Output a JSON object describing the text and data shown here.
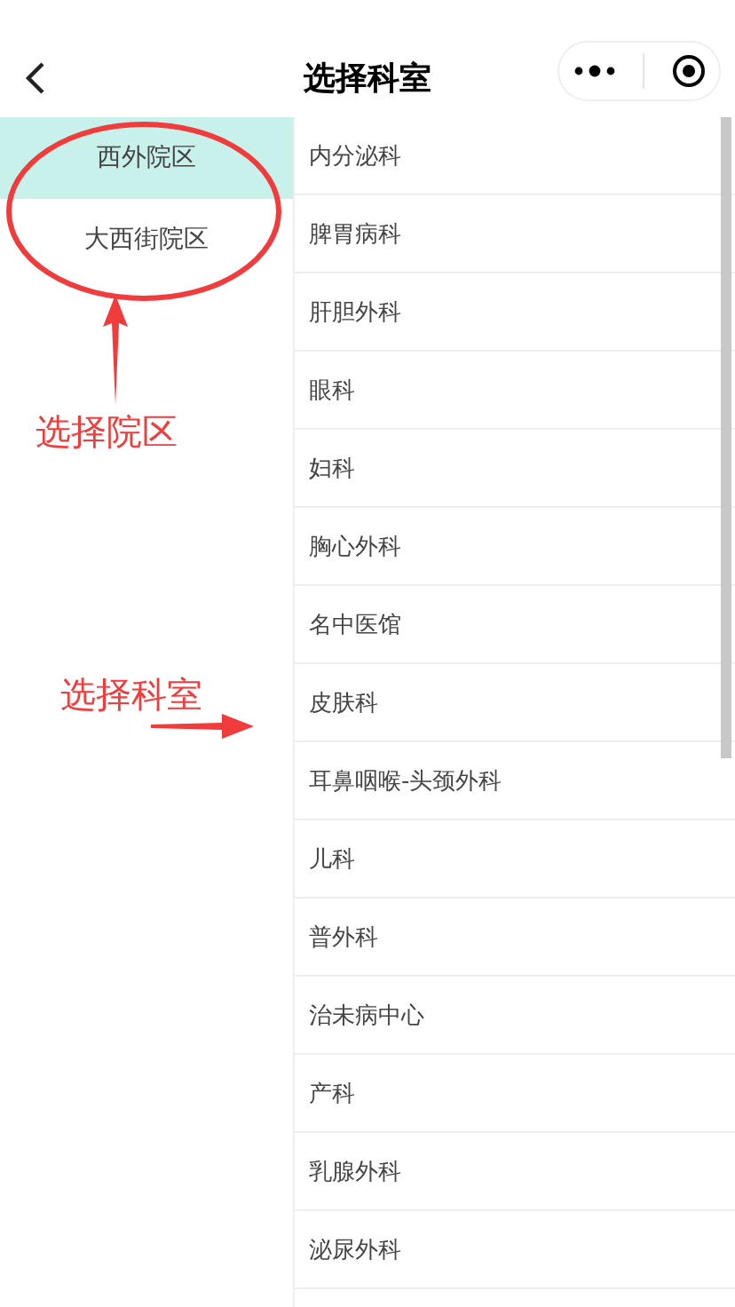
{
  "header": {
    "title": "选择科室"
  },
  "campuses": [
    {
      "label": "西外院区",
      "selected": true
    },
    {
      "label": "大西街院区",
      "selected": false
    }
  ],
  "departments": [
    "内分泌科",
    "脾胃病科",
    "肝胆外科",
    "眼科",
    "妇科",
    "胸心外科",
    "名中医馆",
    "皮肤科",
    "耳鼻咽喉-头颈外科",
    "儿科",
    "普外科",
    "治未病中心",
    "产科",
    "乳腺外科",
    "泌尿外科"
  ],
  "annotations": [
    {
      "kind": "campus",
      "label": "选择院区"
    },
    {
      "kind": "department",
      "label": "选择科室"
    }
  ]
}
